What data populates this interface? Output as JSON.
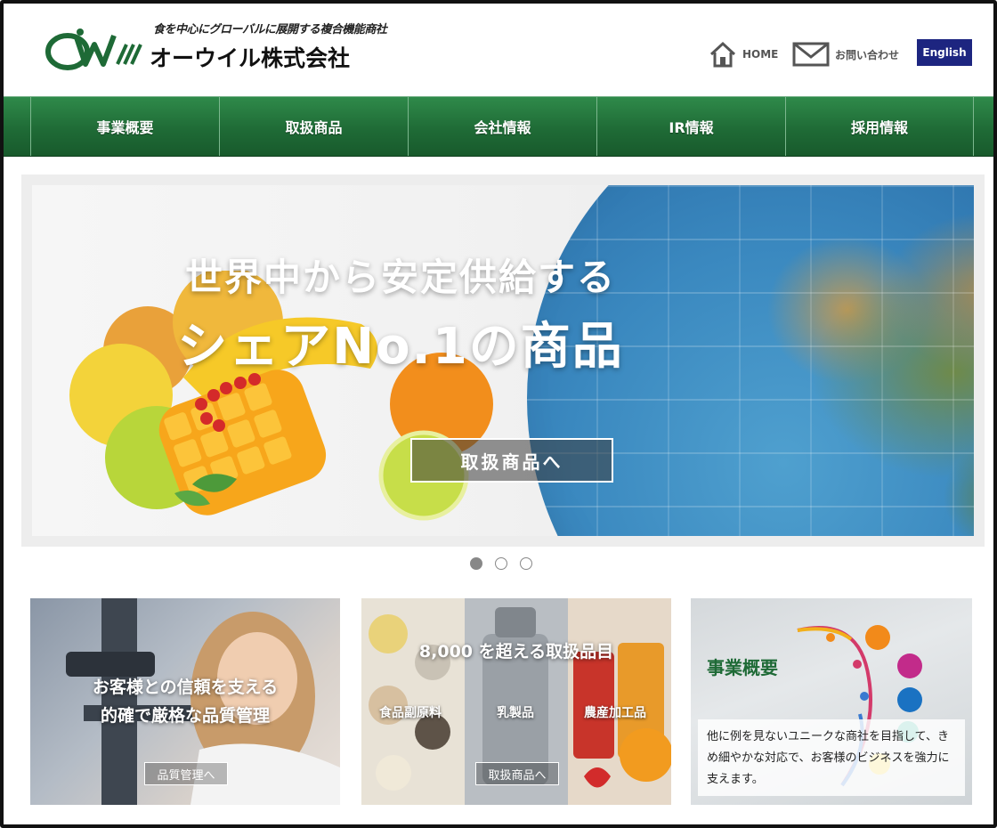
{
  "header": {
    "tagline": "食を中心にグローバルに展開する複合機能商社",
    "company_name": "オーウイル株式会社",
    "nav": {
      "home_label": "HOME",
      "contact_label": "お問い合わせ",
      "english_label": "English"
    }
  },
  "main_nav": {
    "items": [
      {
        "label": "事業概要"
      },
      {
        "label": "取扱商品"
      },
      {
        "label": "会社情報"
      },
      {
        "label": "IR情報"
      },
      {
        "label": "採用情報"
      }
    ]
  },
  "hero": {
    "line1": "世界中から安定供給する",
    "line2": "シェアNo.1の商品",
    "button_label": "取扱商品へ",
    "slides": [
      {
        "active": true
      },
      {
        "active": false
      },
      {
        "active": false
      }
    ]
  },
  "cards": {
    "quality": {
      "title_line1": "お客様との信頼を支える",
      "title_line2": "的確で厳格な品質管理",
      "button_label": "品質管理へ"
    },
    "products": {
      "title": "8,000 を超える取扱品目",
      "col1": "食品副原料",
      "col2": "乳製品",
      "col3": "農産加工品",
      "button_label": "取扱商品へ"
    },
    "business": {
      "title": "事業概要",
      "text": "他に例を見ないユニークな商社を目指して、きめ細やかな対応で、お客様のビジネスを強力に支えます。"
    }
  },
  "colors": {
    "nav_green": "#1f6b36",
    "english_navy": "#1d2580",
    "business_green": "#1e6a36"
  }
}
